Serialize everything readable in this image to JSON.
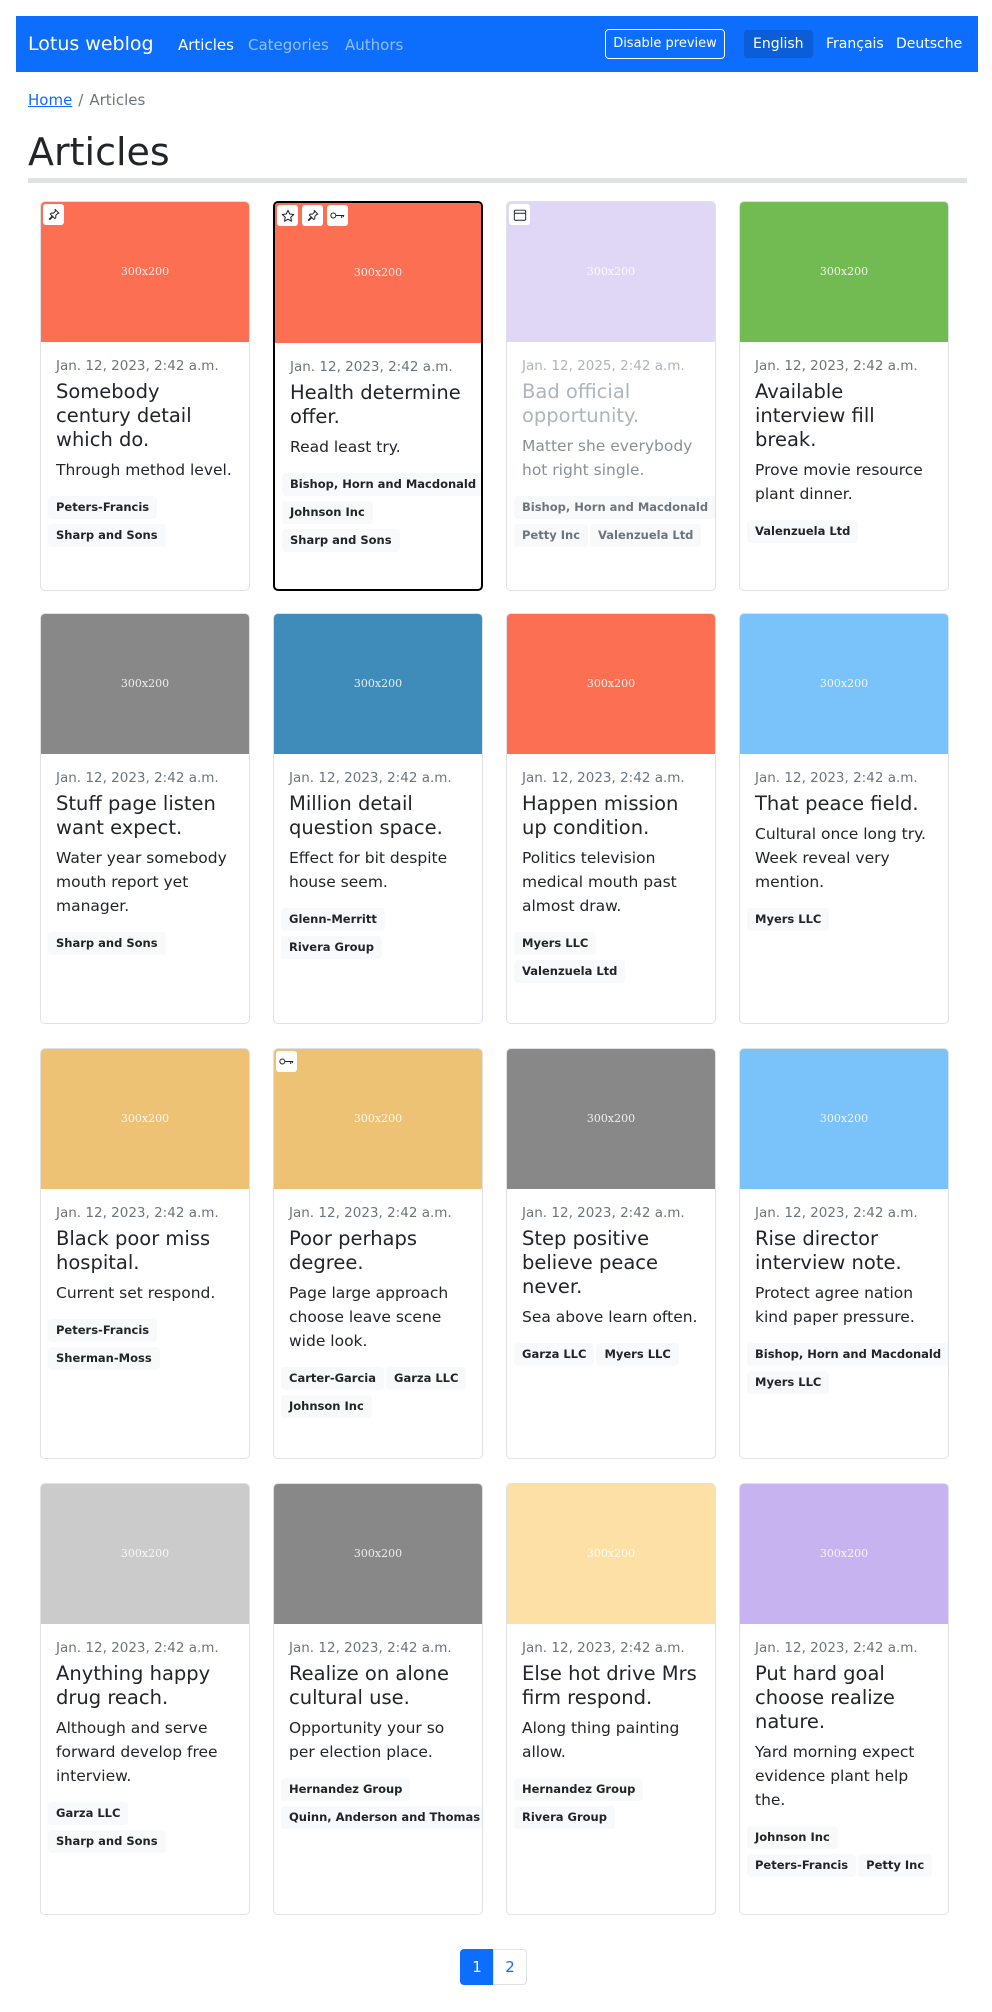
{
  "nav": {
    "brand": "Lotus weblog",
    "links": [
      "Articles",
      "Categories",
      "Authors"
    ],
    "preview_button": "Disable preview",
    "languages": [
      "English",
      "Français",
      "Deutsche"
    ]
  },
  "breadcrumb": {
    "home": "Home",
    "separator": "/",
    "current": "Articles"
  },
  "page_title": "Articles",
  "cards": [
    {
      "image_text": "300x200",
      "image_color": "#fd6f53",
      "icons": [
        "pin-icon"
      ],
      "date": "Jan. 12, 2023, 2:42 a.m.",
      "title": "Somebody century detail which do.",
      "text": "Through method level.",
      "badges": [
        "Peters-Francis",
        "Sharp and Sons"
      ]
    },
    {
      "image_text": "300x200",
      "image_color": "#fd6f53",
      "icons": [
        "star-icon",
        "pin-icon",
        "key-icon"
      ],
      "date": "Jan. 12, 2023, 2:42 a.m.",
      "title": "Health determine offer.",
      "text": "Read least try.",
      "badges": [
        "Bishop, Horn and Macdonald",
        "Johnson Inc",
        "Sharp and Sons"
      ]
    },
    {
      "image_text": "300x200",
      "image_color": "#dcd3f4",
      "icons": [
        "calendar-icon"
      ],
      "date": "Jan. 12, 2025, 2:42 a.m.",
      "title": "Bad official opportunity.",
      "text": "Matter she everybody hot right single.",
      "badges": [
        "Bishop, Horn and Macdonald",
        "Petty Inc",
        "Valenzuela Ltd"
      ]
    },
    {
      "image_text": "300x200",
      "image_color": "#72bb52",
      "icons": [],
      "date": "Jan. 12, 2023, 2:42 a.m.",
      "title": "Available interview fill break.",
      "text": "Prove movie resource plant dinner.",
      "badges": [
        "Valenzuela Ltd"
      ]
    },
    {
      "image_text": "300x200",
      "image_color": "#888888",
      "icons": [],
      "date": "Jan. 12, 2023, 2:42 a.m.",
      "title": "Stuff page listen want expect.",
      "text": "Water year somebody mouth report yet manager.",
      "badges": [
        "Sharp and Sons"
      ]
    },
    {
      "image_text": "300x200",
      "image_color": "#3f8cba",
      "icons": [],
      "date": "Jan. 12, 2023, 2:42 a.m.",
      "title": "Million detail question space.",
      "text": "Effect for bit despite house seem.",
      "badges": [
        "Glenn-Merritt",
        "Rivera Group"
      ]
    },
    {
      "image_text": "300x200",
      "image_color": "#fd6f53",
      "icons": [],
      "date": "Jan. 12, 2023, 2:42 a.m.",
      "title": "Happen mission up condition.",
      "text": "Politics television medical mouth past almost draw.",
      "badges": [
        "Myers LLC",
        "Valenzuela Ltd"
      ]
    },
    {
      "image_text": "300x200",
      "image_color": "#7ac2fa",
      "icons": [],
      "date": "Jan. 12, 2023, 2:42 a.m.",
      "title": "That peace field.",
      "text": "Cultural once long try. Week reveal very mention.",
      "badges": [
        "Myers LLC"
      ]
    },
    {
      "image_text": "300x200",
      "image_color": "#eec275",
      "icons": [],
      "date": "Jan. 12, 2023, 2:42 a.m.",
      "title": "Black poor miss hospital.",
      "text": "Current set respond.",
      "badges": [
        "Peters-Francis",
        "Sherman-Moss"
      ]
    },
    {
      "image_text": "300x200",
      "image_color": "#eec275",
      "icons": [
        "key-icon"
      ],
      "date": "Jan. 12, 2023, 2:42 a.m.",
      "title": "Poor perhaps degree.",
      "text": "Page large approach choose leave scene wide look.",
      "badges": [
        "Carter-Garcia",
        "Garza LLC",
        "Johnson Inc"
      ]
    },
    {
      "image_text": "300x200",
      "image_color": "#888888",
      "icons": [],
      "date": "Jan. 12, 2023, 2:42 a.m.",
      "title": "Step positive believe peace never.",
      "text": "Sea above learn often.",
      "badges": [
        "Garza LLC",
        "Myers LLC"
      ]
    },
    {
      "image_text": "300x200",
      "image_color": "#7ac2fa",
      "icons": [],
      "date": "Jan. 12, 2023, 2:42 a.m.",
      "title": "Rise director interview note.",
      "text": "Protect agree nation kind paper pressure.",
      "badges": [
        "Bishop, Horn and Macdonald",
        "Myers LLC"
      ]
    },
    {
      "image_text": "300x200",
      "image_color": "#cbcbcb",
      "icons": [],
      "date": "Jan. 12, 2023, 2:42 a.m.",
      "title": "Anything happy drug reach.",
      "text": "Although and serve forward develop free interview.",
      "badges": [
        "Garza LLC",
        "Sharp and Sons"
      ]
    },
    {
      "image_text": "300x200",
      "image_color": "#888888",
      "icons": [],
      "date": "Jan. 12, 2023, 2:42 a.m.",
      "title": "Realize on alone cultural use.",
      "text": "Opportunity your so per election place.",
      "badges": [
        "Hernandez Group",
        "Quinn, Anderson and Thomas"
      ]
    },
    {
      "image_text": "300x200",
      "image_color": "#fde0a5",
      "icons": [],
      "date": "Jan. 12, 2023, 2:42 a.m.",
      "title": "Else hot drive Mrs firm respond.",
      "text": "Along thing painting allow.",
      "badges": [
        "Hernandez Group",
        "Rivera Group"
      ]
    },
    {
      "image_text": "300x200",
      "image_color": "#c6b3ef",
      "icons": [],
      "date": "Jan. 12, 2023, 2:42 a.m.",
      "title": "Put hard goal choose realize nature.",
      "text": "Yard morning expect evidence plant help the.",
      "badges": [
        "Johnson Inc",
        "Peters-Francis",
        "Petty Inc"
      ]
    }
  ],
  "pagination": {
    "pages": [
      "1",
      "2"
    ],
    "current": "1"
  },
  "colors": {
    "primary": "#0d6efd",
    "selected_border": "#000000",
    "badge_bg": "#f8f9fa"
  }
}
